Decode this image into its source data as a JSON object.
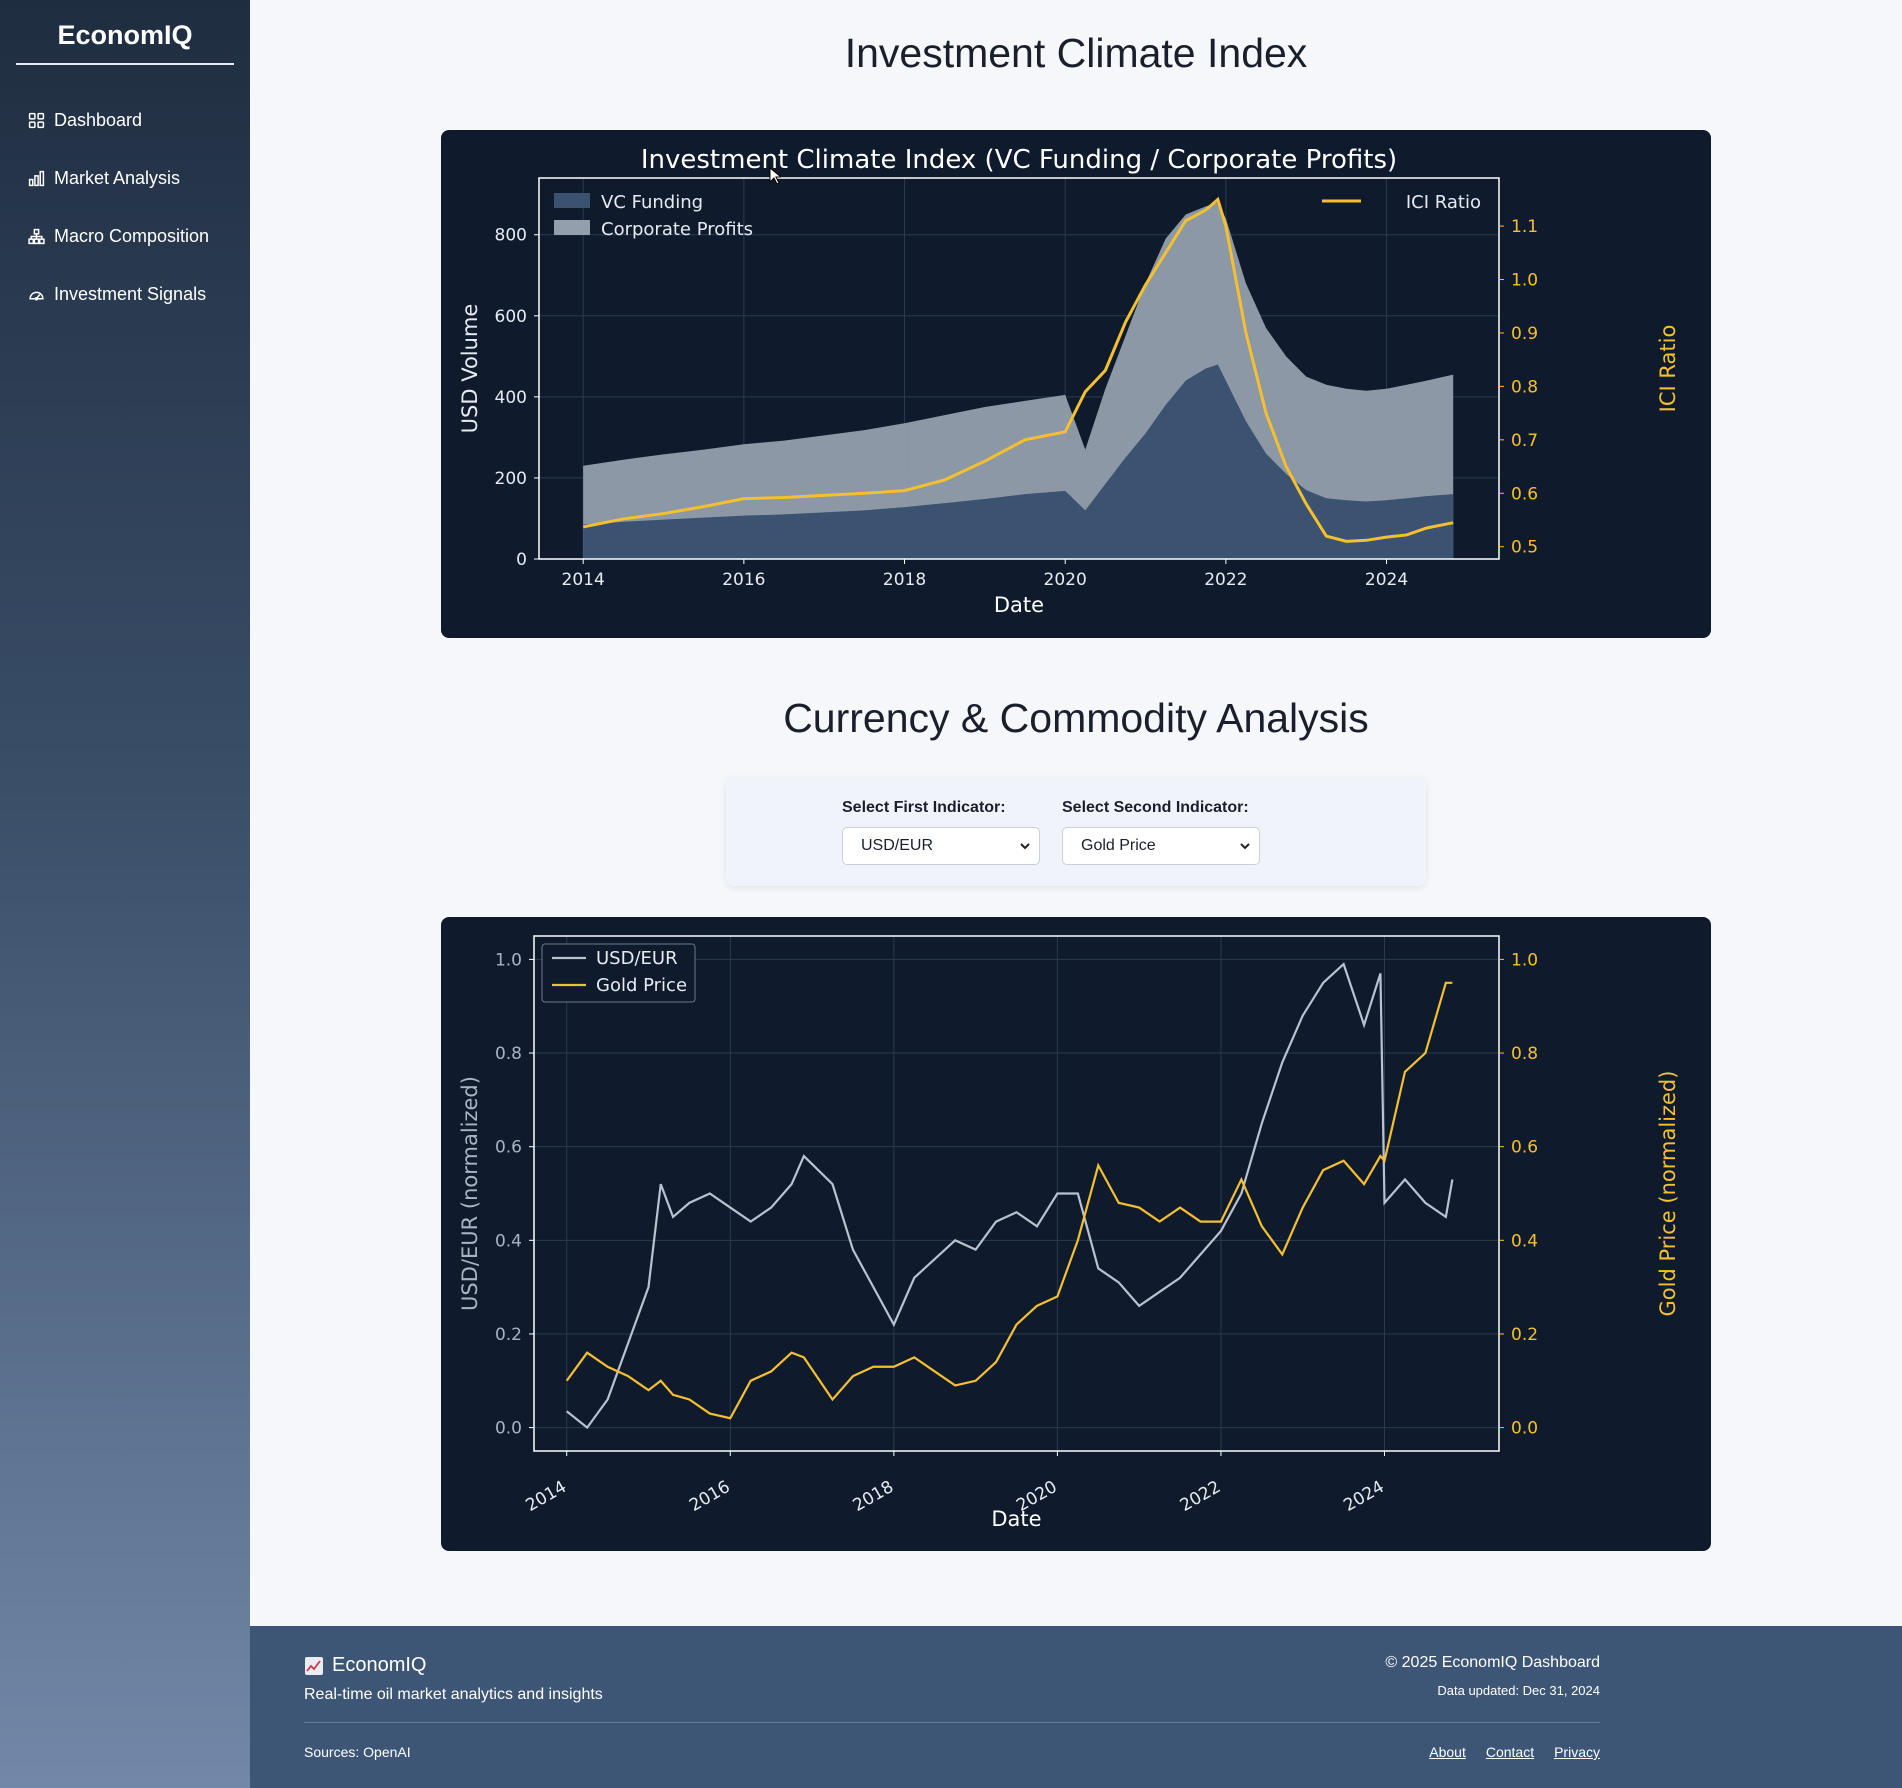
{
  "sidebar": {
    "brand": "EconomIQ",
    "items": [
      {
        "label": "Dashboard",
        "icon": "grid-icon"
      },
      {
        "label": "Market Analysis",
        "icon": "bar-chart-icon"
      },
      {
        "label": "Macro Composition",
        "icon": "hierarchy-icon"
      },
      {
        "label": "Investment Signals",
        "icon": "gauge-icon"
      }
    ]
  },
  "main": {
    "page_title": "Investment Climate Index",
    "section_title": "Currency & Commodity Analysis",
    "selectors": {
      "first_label": "Select First Indicator:",
      "first_value": "USD/EUR",
      "second_label": "Select Second Indicator:",
      "second_value": "Gold Price"
    }
  },
  "footer": {
    "brand": "EconomIQ",
    "tagline": "Real-time oil market analytics and insights",
    "copyright": "© 2025 EconomIQ Dashboard",
    "updated": "Data updated: Dec 31, 2024",
    "sources": "Sources: OpenAI",
    "links": [
      "About",
      "Contact",
      "Privacy"
    ]
  },
  "colors": {
    "accent": "#f5c02f",
    "chart_bg": "#0f1b2c",
    "vc_area": "#3b5270",
    "profit_area": "#939fad",
    "usd_line": "#b8c2d0"
  },
  "chart_data": [
    {
      "type": "area",
      "title": "Investment Climate Index (VC Funding / Corporate Profits)",
      "xlabel": "Date",
      "ylabel": "USD Volume",
      "y2label": "ICI Ratio",
      "xlim": [
        2013.45,
        2025.4
      ],
      "ylim": [
        0,
        940
      ],
      "y2lim": [
        0.477,
        1.19
      ],
      "xticks": [
        "2014",
        "2016",
        "2018",
        "2020",
        "2022",
        "2024"
      ],
      "yticks": [
        "0",
        "200",
        "400",
        "600",
        "800"
      ],
      "y2ticks": [
        "0.5",
        "0.6",
        "0.7",
        "0.8",
        "0.9",
        "1.0",
        "1.1"
      ],
      "legend": "top-left / top-right",
      "grid": true,
      "x": [
        2014,
        2014.5,
        2015,
        2015.5,
        2016,
        2016.5,
        2017,
        2017.5,
        2018,
        2018.5,
        2019,
        2019.5,
        2020,
        2020.25,
        2020.5,
        2020.75,
        2021,
        2021.25,
        2021.5,
        2021.75,
        2021.9,
        2022,
        2022.25,
        2022.5,
        2022.75,
        2023,
        2023.25,
        2023.5,
        2023.75,
        2024,
        2024.25,
        2024.5,
        2024.83
      ],
      "series": [
        {
          "name": "VC Funding",
          "values": [
            85,
            92,
            97,
            102,
            107,
            110,
            115,
            120,
            128,
            138,
            148,
            160,
            168,
            120,
            185,
            250,
            310,
            380,
            440,
            470,
            480,
            440,
            340,
            260,
            210,
            170,
            150,
            145,
            142,
            145,
            150,
            155,
            160
          ]
        },
        {
          "name": "Corporate Profits",
          "values": [
            230,
            245,
            258,
            270,
            283,
            292,
            305,
            318,
            335,
            355,
            375,
            390,
            405,
            270,
            420,
            550,
            680,
            790,
            850,
            870,
            880,
            840,
            680,
            570,
            500,
            450,
            430,
            420,
            415,
            420,
            430,
            440,
            455
          ]
        },
        {
          "name": "ICI Ratio",
          "values": [
            0.537,
            0.552,
            0.562,
            0.575,
            0.59,
            0.592,
            0.596,
            0.6,
            0.605,
            0.625,
            0.66,
            0.7,
            0.715,
            0.79,
            0.83,
            0.92,
            0.99,
            1.05,
            1.11,
            1.13,
            1.15,
            1.1,
            0.9,
            0.75,
            0.65,
            0.58,
            0.52,
            0.51,
            0.512,
            0.518,
            0.522,
            0.535,
            0.545
          ]
        }
      ]
    },
    {
      "type": "line",
      "title": "",
      "xlabel": "Date",
      "ylabel": "USD/EUR (normalized)",
      "y2label": "Gold Price (normalized)",
      "xlim": [
        2013.6,
        2025.4
      ],
      "ylim": [
        -0.05,
        1.05
      ],
      "y2lim": [
        -0.05,
        1.05
      ],
      "xticks": [
        "2014",
        "2016",
        "2018",
        "2020",
        "2022",
        "2024"
      ],
      "yticks": [
        "0.0",
        "0.2",
        "0.4",
        "0.6",
        "0.8",
        "1.0"
      ],
      "y2ticks": [
        "0.0",
        "0.2",
        "0.4",
        "0.6",
        "0.8",
        "1.0"
      ],
      "legend": "top-left",
      "grid": true,
      "x": [
        2014,
        2014.25,
        2014.5,
        2014.75,
        2015,
        2015.15,
        2015.3,
        2015.5,
        2015.75,
        2016,
        2016.25,
        2016.5,
        2016.75,
        2016.9,
        2017.25,
        2017.5,
        2017.75,
        2018,
        2018.25,
        2018.5,
        2018.75,
        2019,
        2019.25,
        2019.5,
        2019.75,
        2020,
        2020.25,
        2020.5,
        2020.75,
        2021,
        2021.25,
        2021.5,
        2021.75,
        2022,
        2022.25,
        2022.5,
        2022.75,
        2023,
        2023.25,
        2023.5,
        2023.75,
        2023.95,
        2024,
        2024.25,
        2024.5,
        2024.75,
        2024.83
      ],
      "series": [
        {
          "name": "USD/EUR",
          "values": [
            0.035,
            0.0,
            0.06,
            0.18,
            0.3,
            0.52,
            0.45,
            0.48,
            0.5,
            0.47,
            0.44,
            0.47,
            0.52,
            0.58,
            0.52,
            0.38,
            0.3,
            0.22,
            0.32,
            0.36,
            0.4,
            0.38,
            0.44,
            0.46,
            0.43,
            0.5,
            0.5,
            0.34,
            0.31,
            0.26,
            0.29,
            0.32,
            0.37,
            0.42,
            0.5,
            0.65,
            0.78,
            0.88,
            0.95,
            0.99,
            0.86,
            0.97,
            0.48,
            0.53,
            0.48,
            0.45,
            0.53
          ]
        },
        {
          "name": "Gold Price",
          "values": [
            0.1,
            0.16,
            0.13,
            0.11,
            0.08,
            0.1,
            0.07,
            0.06,
            0.03,
            0.02,
            0.1,
            0.12,
            0.16,
            0.15,
            0.06,
            0.11,
            0.13,
            0.13,
            0.15,
            0.12,
            0.09,
            0.1,
            0.14,
            0.22,
            0.26,
            0.28,
            0.4,
            0.56,
            0.48,
            0.47,
            0.44,
            0.47,
            0.44,
            0.44,
            0.53,
            0.43,
            0.37,
            0.47,
            0.55,
            0.57,
            0.52,
            0.58,
            0.57,
            0.76,
            0.8,
            0.95,
            0.95
          ]
        }
      ]
    }
  ]
}
